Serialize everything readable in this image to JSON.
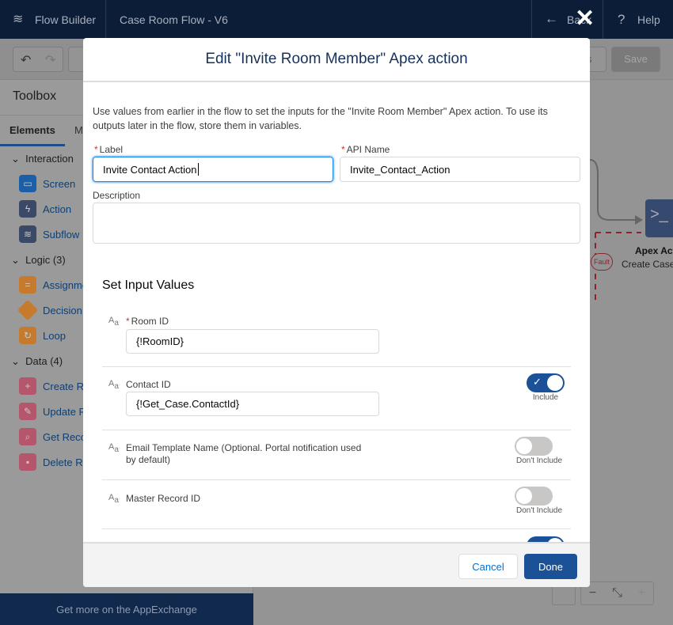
{
  "topbar": {
    "app_name": "Flow Builder",
    "flow_name": "Case Room Flow - V6",
    "back_label": "Back",
    "help_label": "Help"
  },
  "toolbar": {
    "save_label": "Save",
    "partial_label": "s"
  },
  "sidebar": {
    "title": "Toolbox",
    "tabs": [
      {
        "label": "Elements"
      },
      {
        "label": "M"
      }
    ],
    "sections": [
      {
        "label": "Interaction",
        "items": [
          "Screen",
          "Action",
          "Subflow"
        ]
      },
      {
        "label": "Logic (3)",
        "items": [
          "Assignment",
          "Decision",
          "Loop"
        ]
      },
      {
        "label": "Data (4)",
        "items": [
          "Create Records",
          "Update Records",
          "Get Records",
          "Delete Records"
        ]
      }
    ],
    "footer": "Get more on the AppExchange"
  },
  "canvas": {
    "node_title": "Apex Action",
    "node_subtitle": "Create Case",
    "fault_label": "Fault"
  },
  "modal": {
    "title": "Edit \"Invite Room Member\" Apex action",
    "description": "Use values from earlier in the flow to set the inputs for the \"Invite Room Member\" Apex action. To use its outputs later in the flow, store them in variables.",
    "label_label": "Label",
    "label_value": "Invite Contact Action",
    "api_label": "API Name",
    "api_value": "Invite_Contact_Action",
    "desc_label": "Description",
    "desc_value": "",
    "section_title": "Set Input Values",
    "inputs": [
      {
        "label": "Room ID",
        "required": true,
        "value": "{!RoomID}"
      },
      {
        "label": "Contact ID",
        "value": "{!Get_Case.ContactId}",
        "toggle": "Include",
        "on": true
      },
      {
        "label": "Email Template Name (Optional. Portal notification used by default)",
        "toggle": "Don't Include",
        "on": false
      },
      {
        "label": "Master Record ID",
        "toggle": "Don't Include",
        "on": false
      }
    ],
    "cancel": "Cancel",
    "done": "Done"
  },
  "colors": {
    "brand": "#0070d2",
    "done": "#1b5297",
    "navy": "#0c1d38"
  }
}
